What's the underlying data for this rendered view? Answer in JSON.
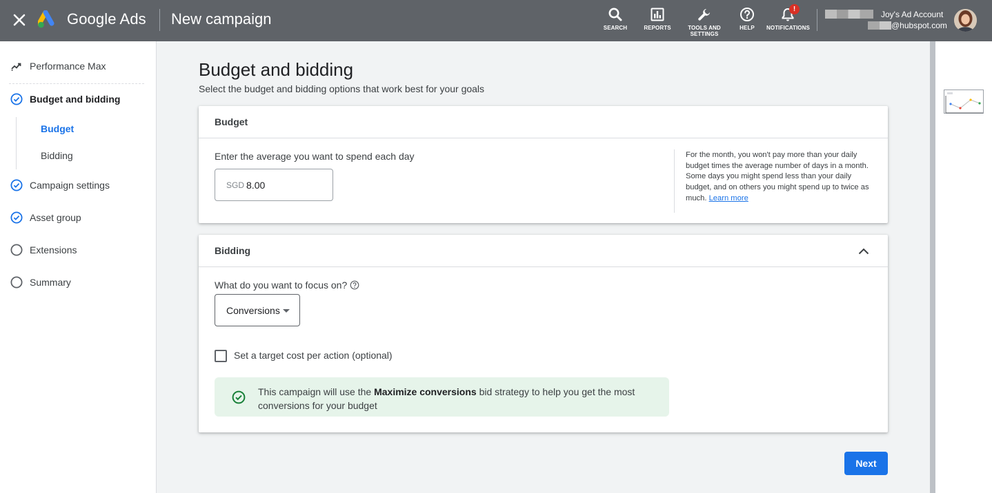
{
  "header": {
    "brand": "Google Ads",
    "page_title": "New campaign",
    "tools": [
      {
        "label": "SEARCH",
        "icon": "search-icon"
      },
      {
        "label": "REPORTS",
        "icon": "reports-icon"
      },
      {
        "label": "TOOLS AND SETTINGS",
        "icon": "wrench-icon"
      },
      {
        "label": "HELP",
        "icon": "help-icon"
      },
      {
        "label": "NOTIFICATIONS",
        "icon": "bell-icon"
      }
    ],
    "notification_badge": "!",
    "account_name": "Joy's Ad Account",
    "account_email": "@hubspot.com"
  },
  "sidebar": {
    "items": [
      {
        "label": "Performance Max",
        "icon": "trend-icon"
      },
      {
        "label": "Budget and bidding",
        "icon": "check-circle-icon"
      },
      {
        "label": "Campaign settings",
        "icon": "check-circle-icon"
      },
      {
        "label": "Asset group",
        "icon": "check-circle-icon"
      },
      {
        "label": "Extensions",
        "icon": "empty-circle-icon"
      },
      {
        "label": "Summary",
        "icon": "empty-circle-icon"
      }
    ],
    "sub_items": [
      {
        "label": "Budget",
        "active": true
      },
      {
        "label": "Bidding",
        "active": false
      }
    ]
  },
  "main": {
    "title": "Budget and bidding",
    "subtitle": "Select the budget and bidding options that work best for your goals",
    "budget": {
      "heading": "Budget",
      "label": "Enter the average you want to spend each day",
      "currency": "SGD",
      "amount": "8.00",
      "note": "For the month, you won't pay more than your daily budget times the average number of days in a month. Some days you might spend less than your daily budget, and on others you might spend up to twice as much.",
      "learn_more": "Learn more"
    },
    "bidding": {
      "heading": "Bidding",
      "focus_label": "What do you want to focus on?",
      "focus_value": "Conversions",
      "target_checkbox_label": "Set a target cost per action (optional)",
      "target_checked": false,
      "info_prefix": "This campaign will use the ",
      "info_strategy": "Maximize conversions",
      "info_suffix": " bid strategy to help you get the most conversions for your budget"
    },
    "next_label": "Next"
  },
  "colors": {
    "topbar": "#5f6368",
    "accent": "#1a73e8",
    "success_bg": "#e6f4ea",
    "success_icon": "#188038",
    "badge": "#d93025"
  }
}
